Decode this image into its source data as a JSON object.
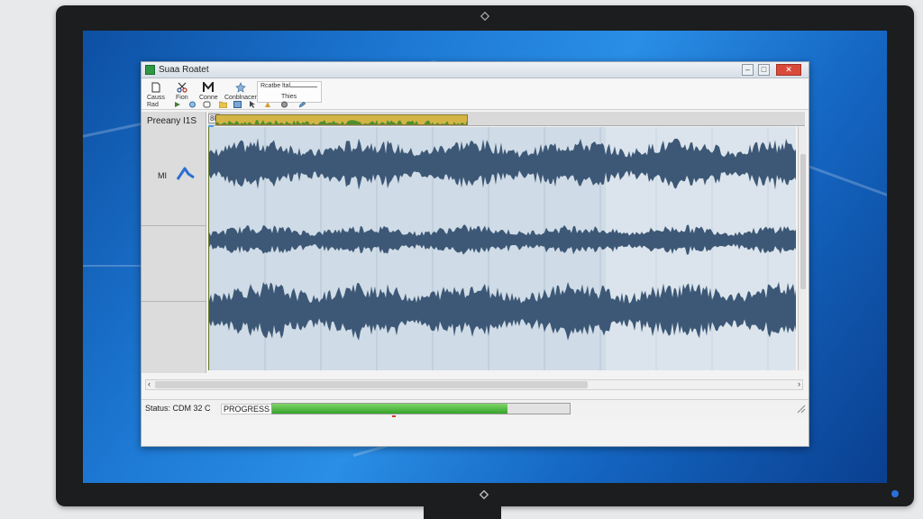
{
  "window": {
    "title": "Suaa Roatet",
    "minimize_label": "–",
    "maximize_label": "□",
    "close_label": "✕"
  },
  "toolbar": {
    "buttons": [
      {
        "label": "Causs",
        "icon": "document-icon"
      },
      {
        "label": "Fion",
        "icon": "scissors-icon"
      },
      {
        "label": "Conne",
        "icon": "connect-icon"
      },
      {
        "label": "Conblnacer",
        "icon": "star-icon"
      }
    ],
    "record_group": {
      "label": "Rcatbe ltal",
      "sublabel": "Thies"
    },
    "row2_first": "Rad"
  },
  "track": {
    "frequency_label": "Preeany I1S",
    "track_label": "MI",
    "timeline_marker": "88"
  },
  "scroll": {
    "left_arrow": "‹",
    "right_arrow": "›"
  },
  "status": {
    "text": "Status: CDM 32 C",
    "progress_label": "PROGRESS",
    "progress": 0.79
  },
  "colors": {
    "waveform": "#3d5876",
    "wave_background": "#cfdbe6",
    "progress_fill": "#35a42a",
    "desktop": "#1d79d4",
    "timeline_strip": "#d4b444"
  }
}
